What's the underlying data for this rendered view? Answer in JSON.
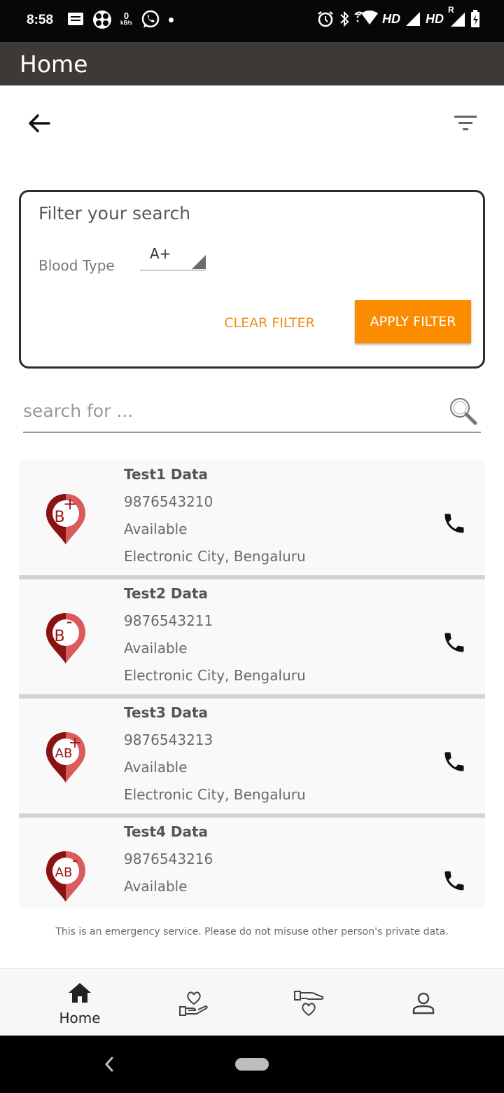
{
  "status_bar": {
    "time": "8:58",
    "net_speed_value": "0",
    "net_speed_unit": "kB/s",
    "hd1": "HD",
    "hd2": "HD",
    "roaming": "R"
  },
  "app_bar": {
    "title": "Home"
  },
  "filter": {
    "title": "Filter your search",
    "blood_type_label": "Blood Type",
    "blood_type_value": "A+",
    "clear_label": "CLEAR FILTER",
    "apply_label": "APPLY FILTER"
  },
  "search": {
    "placeholder": "search for ..."
  },
  "donors": [
    {
      "name": "Test1 Data",
      "phone": "9876543210",
      "status": "Available",
      "location": "Electronic City, Bengaluru",
      "blood_group": "B",
      "sign": "+"
    },
    {
      "name": "Test2 Data",
      "phone": "9876543211",
      "status": "Available",
      "location": "Electronic City, Bengaluru",
      "blood_group": "B",
      "sign": "-"
    },
    {
      "name": "Test3 Data",
      "phone": "9876543213",
      "status": "Available",
      "location": "Electronic City, Bengaluru",
      "blood_group": "AB",
      "sign": "+"
    },
    {
      "name": "Test4 Data",
      "phone": "9876543216",
      "status": "Available",
      "location": "",
      "blood_group": "AB",
      "sign": "-"
    }
  ],
  "disclaimer": "This is an emergency service. Please do not misuse other person's private data.",
  "bottom_nav": {
    "home_label": "Home"
  },
  "colors": {
    "app_bar": "#3d3937",
    "accent": "#fb8c00",
    "pin_dark": "#8b1212",
    "pin_light": "#d95b5b"
  }
}
